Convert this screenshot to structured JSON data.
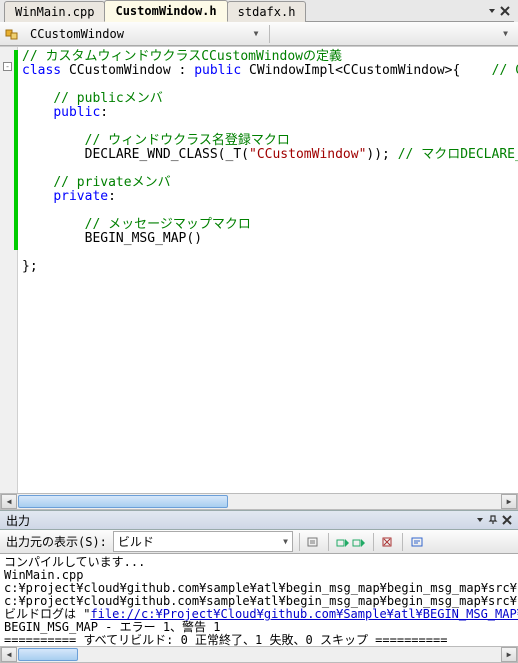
{
  "tabs": {
    "items": [
      {
        "label": "WinMain.cpp",
        "active": false
      },
      {
        "label": "CustomWindow.h",
        "active": true
      },
      {
        "label": "stdafx.h",
        "active": false
      }
    ]
  },
  "nav": {
    "scope": "CCustomWindow",
    "member": ""
  },
  "code": {
    "l1_cm": "// カスタムウィンドウクラスCCustomWindowの定義",
    "l2_kw1": "class",
    "l2_txt1": " CCustomWindow : ",
    "l2_kw2": "public",
    "l2_txt2": " CWindowImpl<CCustomWindow>{    ",
    "l2_cm": "// CWi",
    "l4_cm": "// publicメンバ",
    "l5_kw": "public",
    "l5_txt": ":",
    "l7_cm": "// ウィンドウクラス名登録マクロ",
    "l8_txt1": "DECLARE_WND_CLASS(_T(",
    "l8_str": "\"CCustomWindow\"",
    "l8_txt2": ")); ",
    "l8_cm": "// マクロDECLARE_W",
    "l10_cm": "// privateメンバ",
    "l11_kw": "private",
    "l11_txt": ":",
    "l13_cm": "// メッセージマップマクロ",
    "l14_txt": "BEGIN_MSG_MAP()",
    "l16_txt": "};"
  },
  "output_panel": {
    "title": "出力",
    "source_label": "出力元の表示(S):",
    "source_value": "ビルド",
    "lines": {
      "l1": "コンパイルしています...",
      "l2": "WinMain.cpp",
      "l3": "c:¥project¥cloud¥github.com¥sample¥atl¥begin_msg_map¥begin_msg_map¥src¥begin_msg",
      "l4": "c:¥project¥cloud¥github.com¥sample¥atl¥begin_msg_map¥begin_msg_map¥src¥begin_msg",
      "l5a": "ビルドログは \"",
      "l5b": "file://c:¥Project¥Cloud¥github.com¥Sample¥atl¥BEGIN_MSG_MAP¥BEGIN_",
      "l6": "BEGIN_MSG_MAP - エラー 1、警告 1",
      "l7": "========== すべてリビルド: 0 正常終了、1 失敗、0 スキップ =========="
    }
  }
}
